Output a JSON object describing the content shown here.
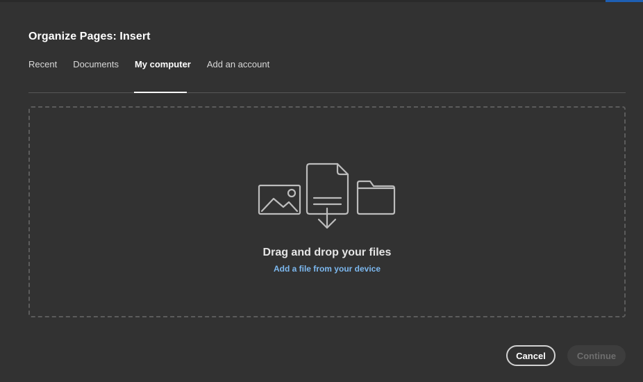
{
  "dialog": {
    "title": "Organize Pages: Insert"
  },
  "tabs": [
    {
      "label": "Recent",
      "active": false
    },
    {
      "label": "Documents",
      "active": false
    },
    {
      "label": "My computer",
      "active": true
    },
    {
      "label": "Add an account",
      "active": false
    }
  ],
  "dropzone": {
    "title": "Drag and drop your files",
    "link": "Add a file from your device",
    "icons": [
      "image-icon",
      "document-download-icon",
      "folder-icon"
    ]
  },
  "footer": {
    "cancel_label": "Cancel",
    "continue_label": "Continue",
    "continue_enabled": false
  },
  "colors": {
    "background": "#323232",
    "link": "#7cb8ef",
    "border": "#5c5c5c"
  }
}
